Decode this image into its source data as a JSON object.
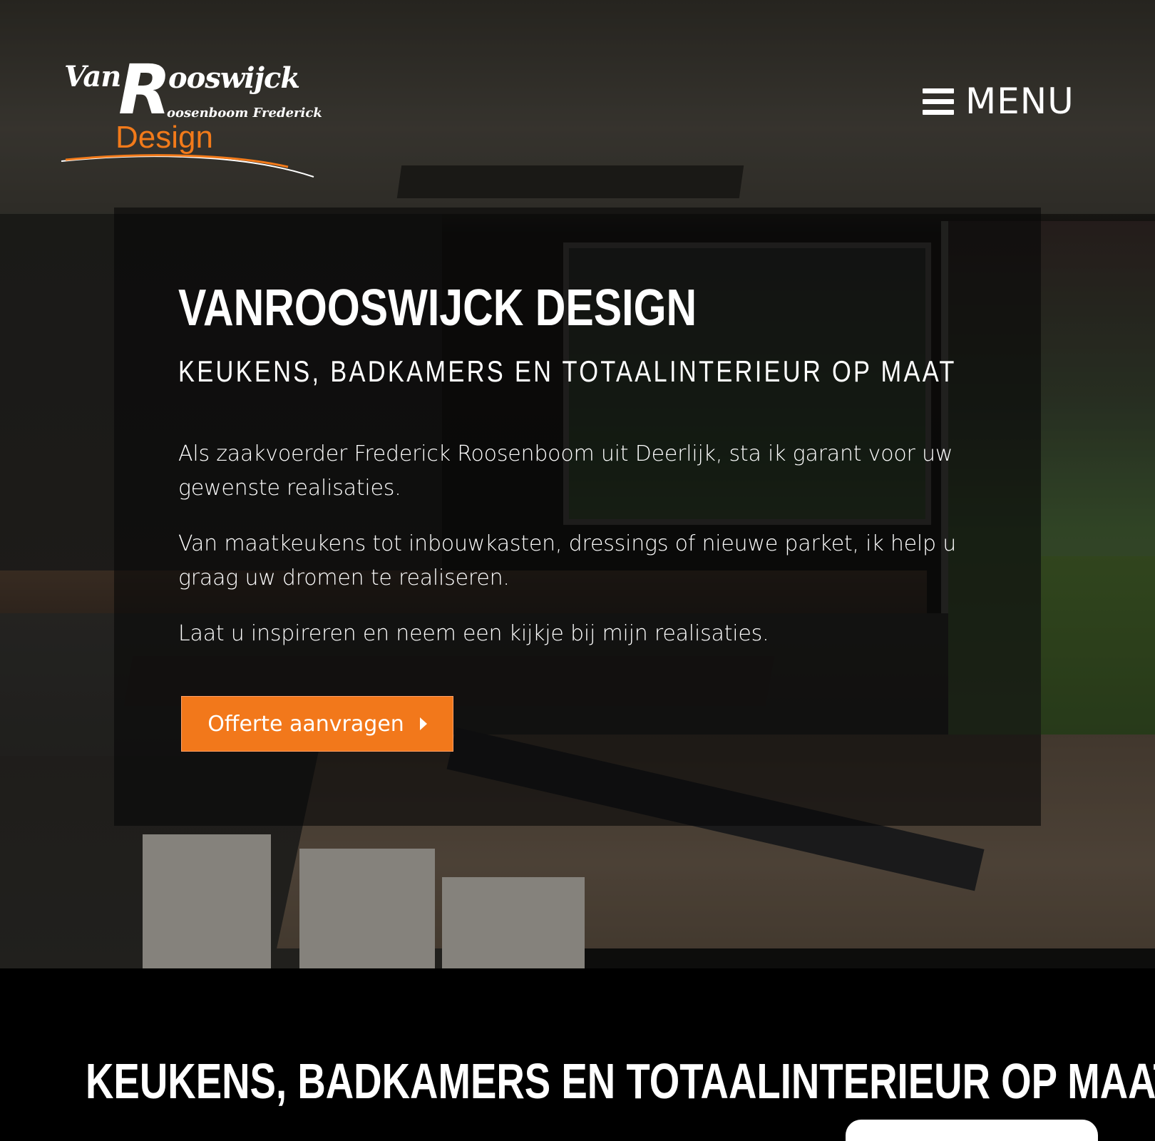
{
  "logo": {
    "van": "Van",
    "big_r": "R",
    "ooswijck": "ooswijck",
    "owner": "oosenboom Frederick",
    "design": "Design"
  },
  "nav": {
    "menu_label": "MENU"
  },
  "hero": {
    "title": "VANROOSWIJCK DESIGN",
    "subtitle": "KEUKENS, BADKAMERS EN TOTAALINTERIEUR OP MAAT",
    "paragraphs": [
      "Als zaakvoerder Frederick Roosenboom uit Deerlijk, sta ik garant voor uw gewenste realisaties.",
      "Van maatkeukens tot inbouwkasten, dressings of nieuwe parket, ik help u graag uw dromen te realiseren.",
      "Laat u inspireren en neem een kijkje bij mijn realisaties."
    ],
    "cta_label": "Offerte aanvragen"
  },
  "section": {
    "heading": "KEUKENS, BADKAMERS EN TOTAALINTERIEUR OP MAAT"
  },
  "colors": {
    "accent": "#f2781b",
    "logo_orange": "#f27a1a",
    "background": "#000000",
    "text": "#ffffff"
  },
  "icons": {
    "menu": "hamburger-icon",
    "cta": "caret-right-icon"
  }
}
